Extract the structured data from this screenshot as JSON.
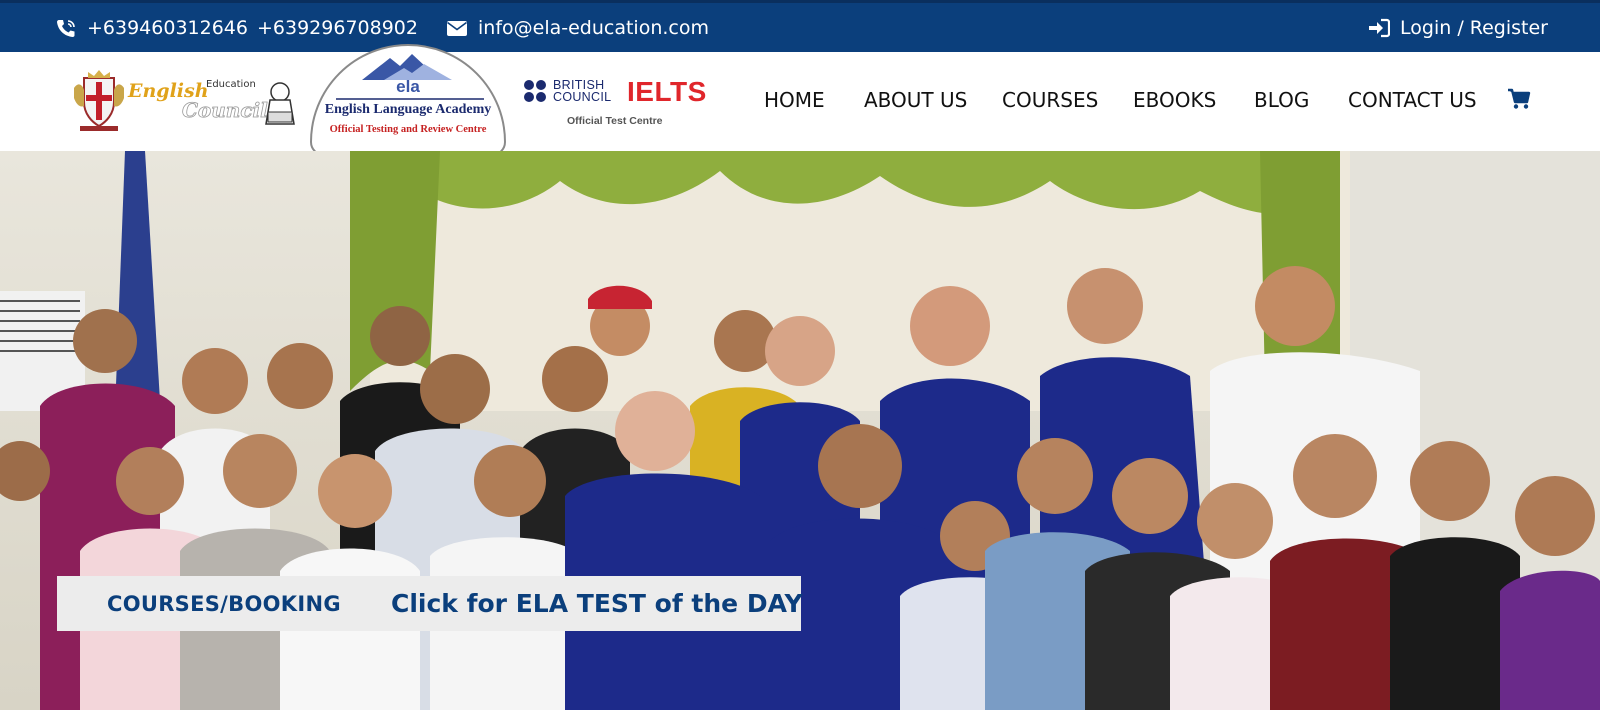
{
  "topbar": {
    "phone_icon": "phone-icon",
    "phone_1": "+639460312646",
    "phone_2": "+639296708902",
    "email_icon": "envelope-icon",
    "email": "info@ela-education.com",
    "login_icon": "sign-in-icon",
    "login_label": "Login / Register"
  },
  "logos": {
    "english_council": {
      "text_1": "English",
      "text_2": "Council",
      "badge": "Education"
    },
    "ela": {
      "word": "ela",
      "name": "English Language Academy",
      "subtitle": "Official Testing and Review Centre"
    },
    "british_council": {
      "line_1": "BRITISH",
      "line_2": "COUNCIL",
      "ielts": "IELTS",
      "subtitle": "Official Test Centre"
    }
  },
  "nav": {
    "items": [
      "HOME",
      "ABOUT US",
      "COURSES",
      "EBOOKS",
      "BLOG",
      "CONTACT US"
    ],
    "cart_icon": "cart-icon"
  },
  "hero": {
    "cta_courses": "COURSES/BOOKING",
    "cta_test": "Click for ELA TEST of the DAY"
  },
  "colors": {
    "topbar_bg": "#0b3f7c",
    "brand_blue": "#0b3f7c",
    "curtain_green": "#8fae3e",
    "polo_navy": "#1d2a8a",
    "ielts_red": "#e0262b"
  }
}
